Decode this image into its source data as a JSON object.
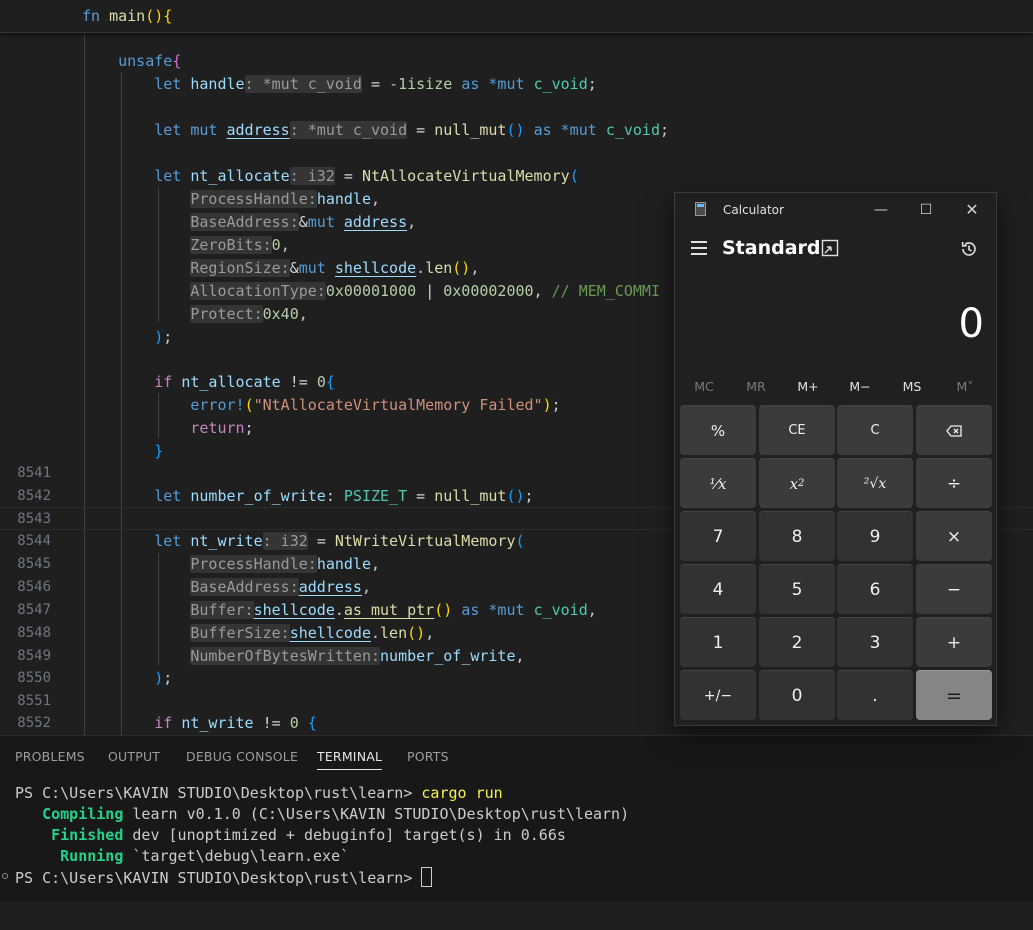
{
  "editor": {
    "sticky_line": "fn main(){",
    "line_numbers": [
      "8541",
      "8542",
      "8543",
      "8544",
      "8545",
      "8546",
      "8547",
      "8548",
      "8549",
      "8550",
      "8551",
      "8552"
    ],
    "tokens": {
      "unsafe": "unsafe",
      "let": "let",
      "mut": "mut",
      "as": "as",
      "handle": "handle",
      "address": "address",
      "nt_allocate": "nt_allocate",
      "nt_write": "nt_write",
      "number_of_write": "number_of_write",
      "hint_mut_c_void": ": *mut c_void",
      "hint_i32": ": i32",
      "neg_one": "-1isize",
      "c_void": "c_void",
      "null_mut": "null_mut",
      "NtAllocateVirtualMemory": "NtAllocateVirtualMemory",
      "NtWriteVirtualMemory": "NtWriteVirtualMemory",
      "ProcessHandle": "ProcessHandle:",
      "BaseAddress": "BaseAddress:",
      "ZeroBits": "ZeroBits:",
      "RegionSize": "RegionSize:",
      "AllocationType": "AllocationType:",
      "Protect": "Protect:",
      "Buffer": "Buffer:",
      "BufferSize": "BufferSize:",
      "NumberOfBytesWritten": "NumberOfBytesWritten:",
      "shellcode": "shellcode",
      "len": "len",
      "as_mut_ptr": "as_mut_ptr",
      "zero": "0",
      "hex_1000": "0x00001000",
      "hex_2000": "0x00002000",
      "hex_40": "0x40",
      "comment": "// MEM_COMMI",
      "if": "if",
      "error": "error!",
      "err_str": "\"NtAllocateVirtualMemory Failed\"",
      "return": "return",
      "PSIZE_T": "PSIZE_T",
      "ne": "!=",
      "isize": "isize"
    }
  },
  "panel": {
    "tabs": [
      "PROBLEMS",
      "OUTPUT",
      "DEBUG CONSOLE",
      "TERMINAL",
      "PORTS"
    ],
    "active_tab": "TERMINAL",
    "terminal": {
      "prompt": "PS C:\\Users\\KAVIN STUDIO\\Desktop\\rust\\learn> ",
      "command": "cargo run",
      "compiling_label": "Compiling",
      "compiling_text": " learn v0.1.0 (C:\\Users\\KAVIN STUDIO\\Desktop\\rust\\learn)",
      "finished_label": "Finished",
      "finished_text": " dev [unoptimized + debuginfo] target(s) in 0.66s",
      "running_label": "Running",
      "running_text": " `target\\debug\\learn.exe`"
    }
  },
  "calculator": {
    "title": "Calculator",
    "mode": "Standard",
    "display": "0",
    "memory": [
      "MC",
      "MR",
      "M+",
      "M−",
      "MS",
      "M˅"
    ],
    "memory_disabled": [
      true,
      true,
      false,
      false,
      false,
      true
    ],
    "keys": {
      "percent": "%",
      "ce": "CE",
      "c": "C",
      "backspace": "⌫",
      "reciprocal": "⅟x",
      "square_base": "x",
      "square_exp": "2",
      "sqrt": "²√x",
      "divide": "÷",
      "seven": "7",
      "eight": "8",
      "nine": "9",
      "multiply": "×",
      "four": "4",
      "five": "5",
      "six": "6",
      "minus": "−",
      "one": "1",
      "two": "2",
      "three": "3",
      "plus": "+",
      "negate": "+/−",
      "zero": "0",
      "decimal": ".",
      "equals": "="
    }
  },
  "colors": {
    "editor_bg": "#1f1f1f",
    "keyword": "#569cd6",
    "function": "#dcdcaa",
    "variable": "#9cdcfe",
    "string": "#ce9178",
    "calc_bg": "#202020",
    "calc_equals": "#858585"
  }
}
